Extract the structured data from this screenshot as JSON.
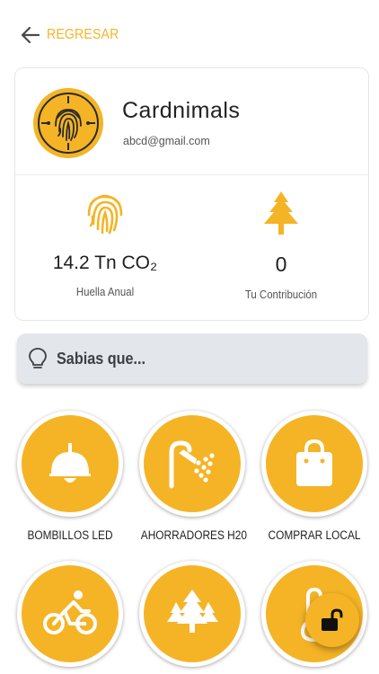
{
  "nav": {
    "back_label": "REGRESAR"
  },
  "profile": {
    "name": "Cardnimals",
    "email": "abcd@gmail.com"
  },
  "stats": [
    {
      "value": "14.2 Tn CO₂",
      "label": "Huella Anual",
      "icon": "fingerprint-icon"
    },
    {
      "value": "0",
      "label": "Tu Contribución",
      "icon": "tree-icon"
    }
  ],
  "tip": {
    "label": "Sabias que...",
    "icon": "lightbulb-icon"
  },
  "categories": [
    {
      "label": "BOMBILLOS LED",
      "icon": "ceiling-lamp-icon"
    },
    {
      "label": "AHORRADORES H20",
      "icon": "shower-icon"
    },
    {
      "label": "COMPRAR LOCAL",
      "icon": "shopping-bag-icon"
    },
    {
      "label": "",
      "icon": "bicycle-icon"
    },
    {
      "label": "",
      "icon": "forest-icon"
    },
    {
      "label": "",
      "icon": "thermometer-icon"
    }
  ],
  "fab": {
    "icon": "unlock-icon"
  },
  "colors": {
    "accent": "#F4B426",
    "tip_bg": "#e3e6ea",
    "icon_white": "#ffffff",
    "text": "#222222"
  }
}
